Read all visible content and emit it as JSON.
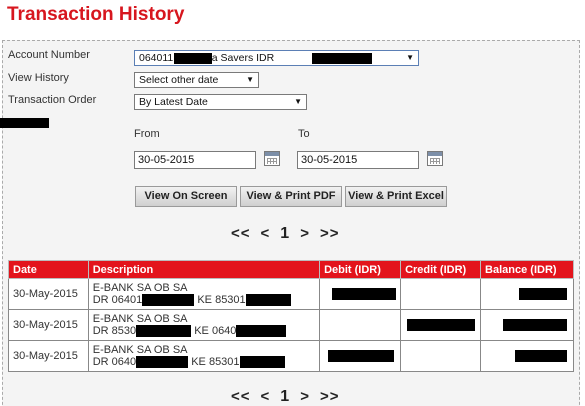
{
  "page": {
    "title": "Transaction History"
  },
  "form": {
    "account_number_label": "Account Number",
    "account_value": "064011          2 AirAsia Savers IDR",
    "view_history_label": "View History",
    "view_history_value": "Select other date",
    "transaction_order_label": "Transaction Order",
    "transaction_order_value": "By Latest Date",
    "from_label": "From",
    "to_label": "To",
    "from_date": "30-05-2015",
    "to_date": "30-05-2015"
  },
  "buttons": {
    "view_on_screen": "View On Screen",
    "view_print_pdf": "View & Print PDF",
    "view_print_excel": "View & Print Excel"
  },
  "pager": {
    "first": "<<",
    "prev": "<",
    "page": "1",
    "next": ">",
    "last": ">>"
  },
  "table": {
    "headers": [
      "Date",
      "Description",
      "Debit (IDR)",
      "Credit (IDR)",
      "Balance (IDR)"
    ],
    "rows": [
      {
        "date": "30-May-2015",
        "desc1": "E-BANK SA OB SA",
        "desc2a": "DR 06401",
        "desc2b": "KE 85301"
      },
      {
        "date": "30-May-2015",
        "desc1": "E-BANK SA OB SA",
        "desc2a": "DR 8530",
        "desc2b": "KE 0640"
      },
      {
        "date": "30-May-2015",
        "desc1": "E-BANK SA OB SA",
        "desc2a": "DR 0640",
        "desc2b": "KE 85301"
      }
    ]
  },
  "colors": {
    "accent": "#d7161e",
    "header_bg": "#e3141c",
    "panel_bg": "#f4f4f4"
  }
}
